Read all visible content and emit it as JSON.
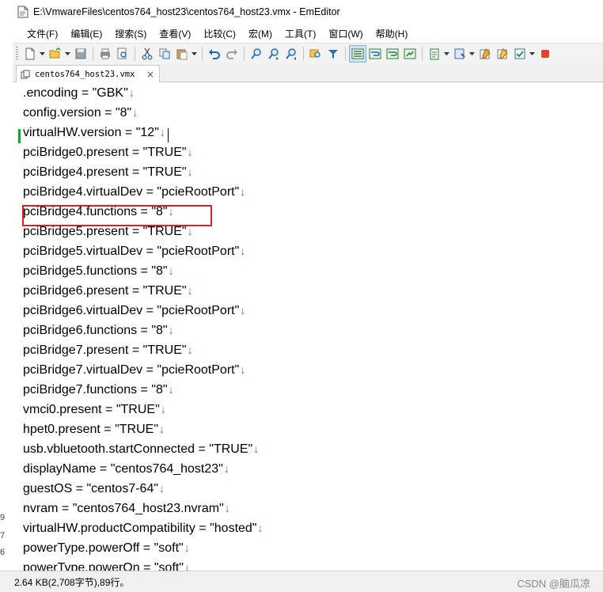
{
  "window": {
    "title": "E:\\VmwareFiles\\centos764_host23\\centos764_host23.vmx - EmEditor"
  },
  "menu": [
    {
      "label": "文件(F)"
    },
    {
      "label": "编辑(E)"
    },
    {
      "label": "搜索(S)"
    },
    {
      "label": "查看(V)"
    },
    {
      "label": "比较(C)"
    },
    {
      "label": "宏(M)"
    },
    {
      "label": "工具(T)"
    },
    {
      "label": "窗口(W)"
    },
    {
      "label": "帮助(H)"
    }
  ],
  "toolbar": {
    "icons": [
      "new-file-icon",
      "open-folder-icon",
      "save-icon",
      "print-icon",
      "print-preview-icon",
      "cut-icon",
      "copy-icon",
      "paste-icon",
      "undo-icon",
      "redo-icon",
      "find-icon",
      "find-next-icon",
      "find-prev-icon",
      "find-in-files-icon",
      "filter-icon",
      "normal-mode-icon",
      "wrap-window-icon",
      "wrap-ruler-icon",
      "wrap-page-icon",
      "clipboard-icon",
      "macro-icon",
      "customize-icon",
      "config-icon",
      "checklist-icon",
      "record-icon"
    ]
  },
  "tab": {
    "label": "centos764_host23.vmx",
    "close": "×"
  },
  "editor": {
    "eol_mark": "↓",
    "lines": [
      ".encoding = \"GBK\"",
      "config.version = \"8\"",
      "virtualHW.version = \"12\"",
      "pciBridge0.present = \"TRUE\"",
      "pciBridge4.present = \"TRUE\"",
      "pciBridge4.virtualDev = \"pcieRootPort\"",
      "pciBridge4.functions = \"8\"",
      "pciBridge5.present = \"TRUE\"",
      "pciBridge5.virtualDev = \"pcieRootPort\"",
      "pciBridge5.functions = \"8\"",
      "pciBridge6.present = \"TRUE\"",
      "pciBridge6.virtualDev = \"pcieRootPort\"",
      "pciBridge6.functions = \"8\"",
      "pciBridge7.present = \"TRUE\"",
      "pciBridge7.virtualDev = \"pcieRootPort\"",
      "pciBridge7.functions = \"8\"",
      "vmci0.present = \"TRUE\"",
      "hpet0.present = \"TRUE\"",
      "usb.vbluetooth.startConnected = \"TRUE\"",
      "displayName = \"centos764_host23\"",
      "guestOS = \"centos7-64\"",
      "nvram = \"centos764_host23.nvram\"",
      "virtualHW.productCompatibility = \"hosted\"",
      "powerType.powerOff = \"soft\"",
      "powerType.powerOn = \"soft\""
    ],
    "gutter_digits": [
      "9",
      "7",
      "6"
    ]
  },
  "status": {
    "text": "2.64 KB(2,708字节),89行。",
    "watermark": "CSDN @脑瓜凉"
  },
  "colors": {
    "highlight_box": "#e02020",
    "current_line_marker": "#1aa33a",
    "eol_mark": "#3a78d8"
  }
}
